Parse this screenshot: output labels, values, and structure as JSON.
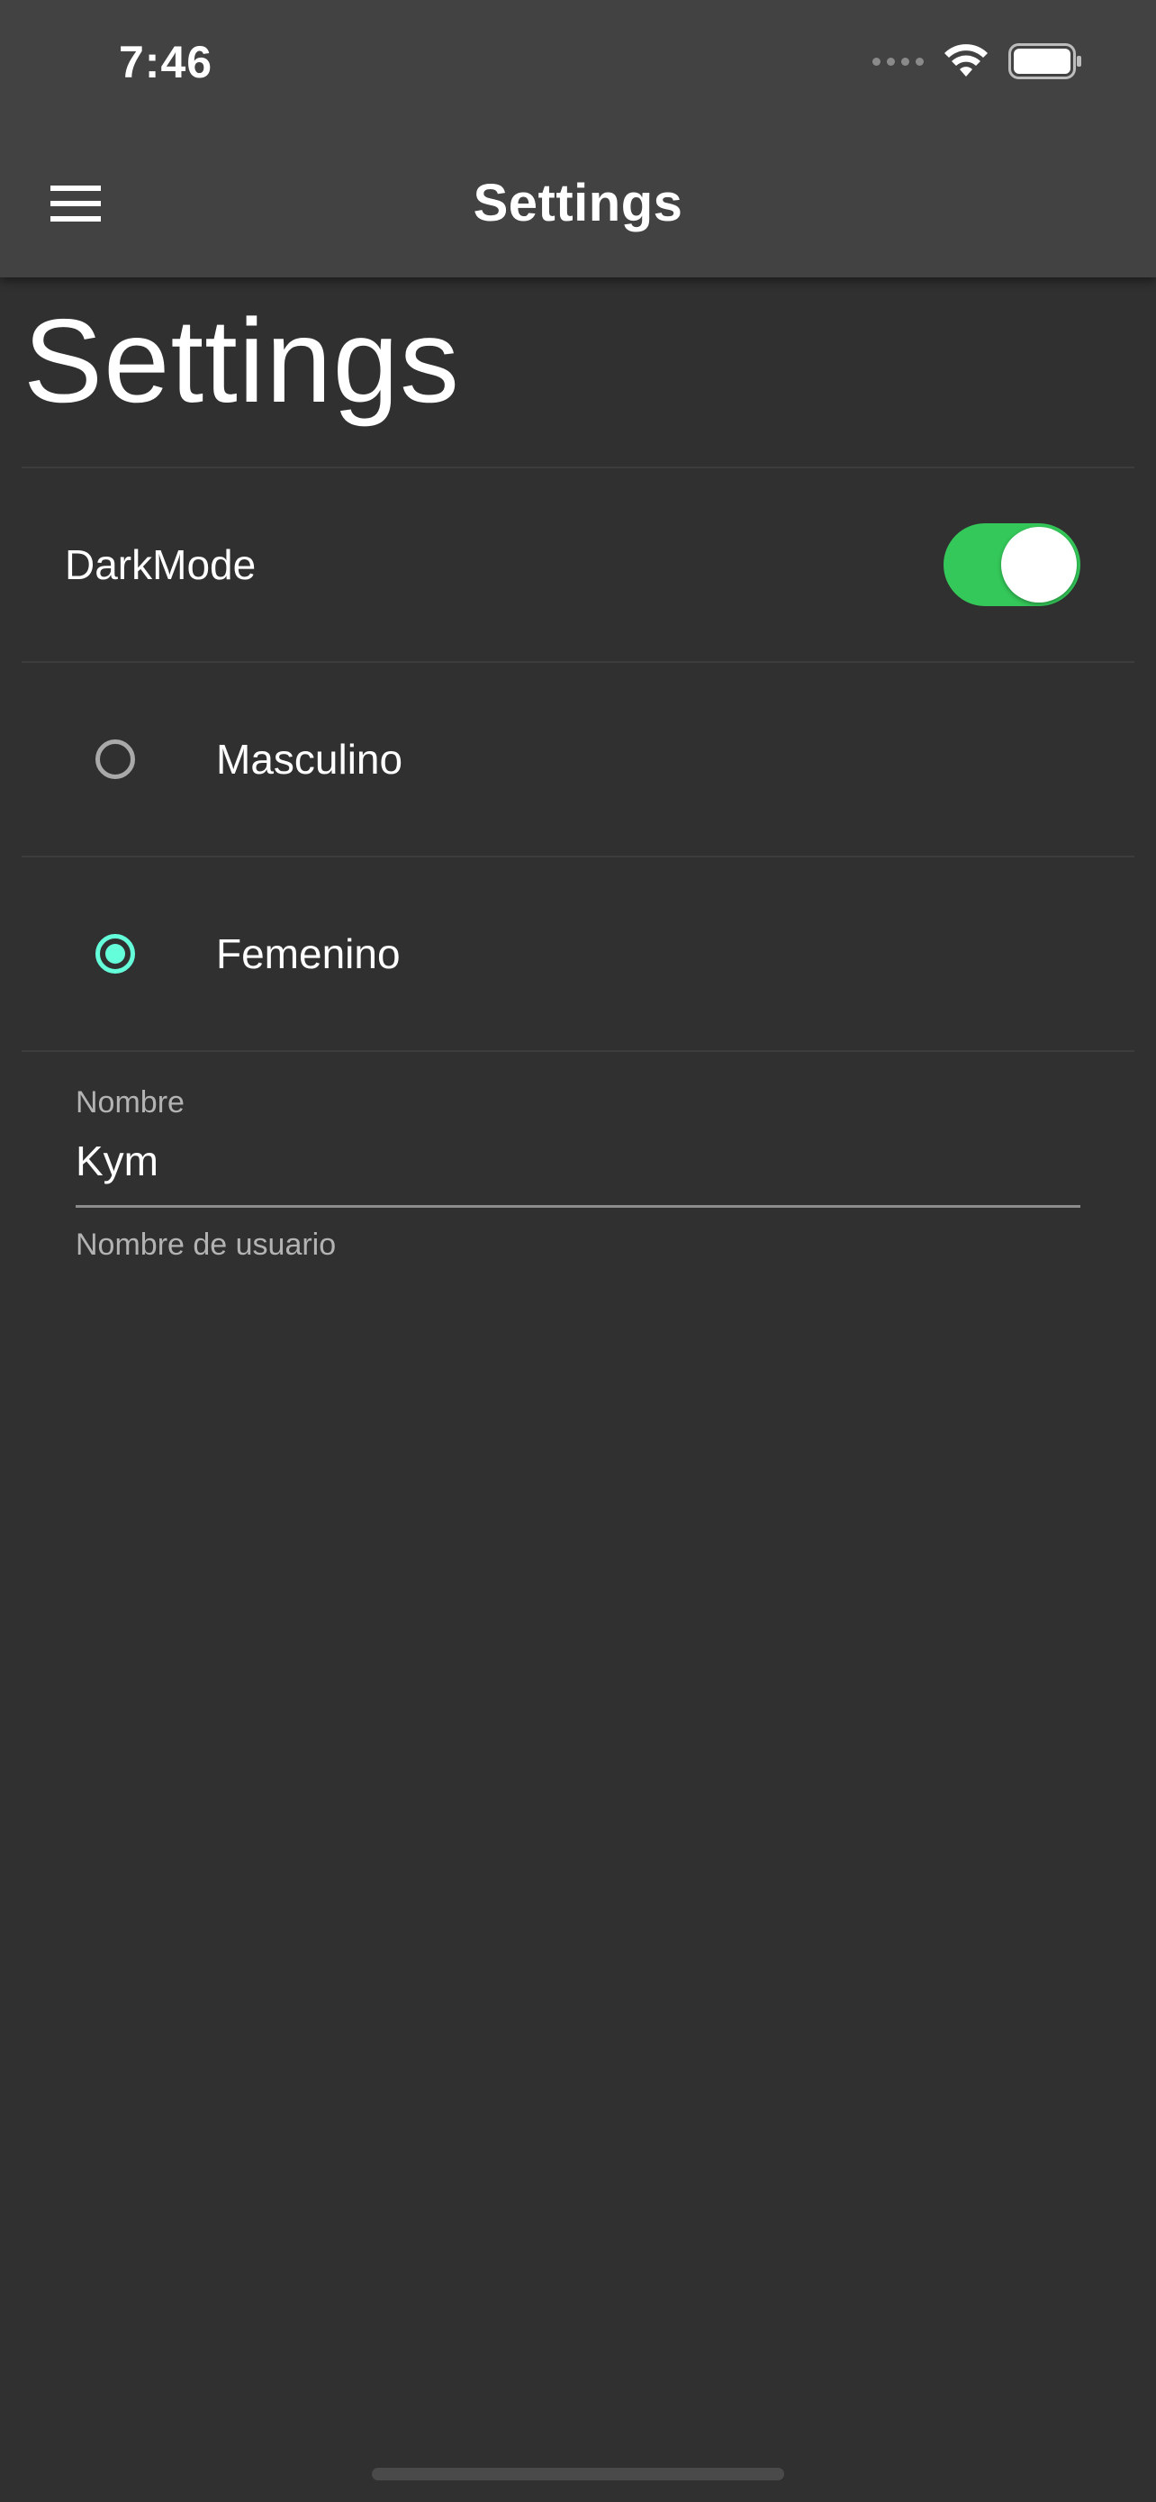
{
  "status_bar": {
    "time": "7:46"
  },
  "app_bar": {
    "title": "Settings",
    "menu_icon": "hamburger-menu-icon"
  },
  "page": {
    "heading": "Settings"
  },
  "settings": {
    "dark_mode": {
      "label": "DarkMode",
      "enabled": true,
      "track_color": "#34c759"
    },
    "gender": {
      "options": [
        {
          "label": "Masculino",
          "selected": false
        },
        {
          "label": "Femenino",
          "selected": true
        }
      ],
      "accent_color": "#64ffda"
    },
    "name_field": {
      "label": "Nombre",
      "value": "Kym",
      "helper": "Nombre de usuario"
    }
  }
}
